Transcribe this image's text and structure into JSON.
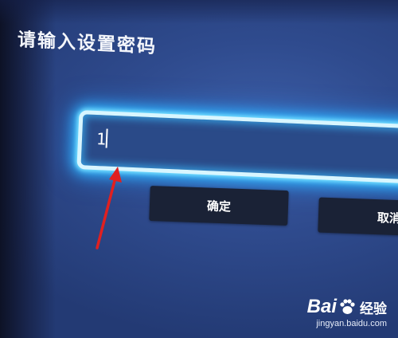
{
  "dialog": {
    "title": "请输入设置密码",
    "password_value": "1",
    "ok_label": "确定",
    "cancel_label": "取消"
  },
  "watermark": {
    "brand_prefix": "Bai",
    "brand_suffix": "经验",
    "url": "jingyan.baidu.com"
  },
  "annotation": {
    "arrow_color": "#e02020"
  },
  "colors": {
    "background": "#2f4b8e",
    "focus_glow": "#33b8ff",
    "button_bg": "#1a2236"
  },
  "icons": [
    "red-arrow-icon",
    "baidu-paw-icon"
  ]
}
